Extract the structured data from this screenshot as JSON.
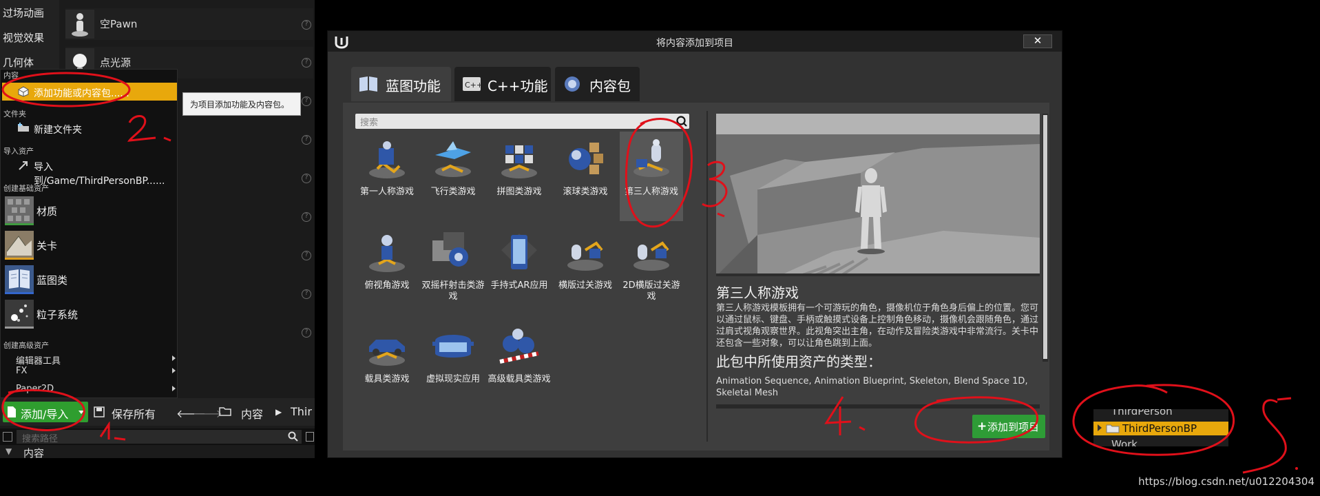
{
  "left_panel": {
    "categories": [
      "过场动画",
      "视觉效果",
      "几何体",
      "内容"
    ],
    "place_items": [
      "空Pawn",
      "点光源"
    ],
    "menu": {
      "sections": {
        "content": "内容",
        "folder": "文件夹",
        "import": "导入资产",
        "basic": "创建基础资产",
        "advanced": "创建高级资产"
      },
      "add_feature": "添加功能或内容包......",
      "new_folder": "新建文件夹",
      "import_to": "导入到/Game/ThirdPersonBP......",
      "basic_assets": [
        "材质",
        "关卡",
        "蓝图类",
        "粒子系统"
      ],
      "advanced_items": [
        "编辑器工具",
        "FX",
        "Paper2D"
      ]
    },
    "tooltip": "为项目添加功能及内容包。",
    "toolbar": {
      "add_import": "添加/导入",
      "save_all": "保存所有",
      "breadcrumb": [
        "内容",
        "Thir"
      ]
    },
    "path_search_placeholder": "搜索路径",
    "tree_root": "内容"
  },
  "annotations": {
    "n1": "1.",
    "n2": "2.",
    "n3": "3.",
    "n4": "4.",
    "n5": "5."
  },
  "dialog": {
    "title": "将内容添加到项目",
    "close": "✕",
    "tabs": [
      {
        "label": "蓝图功能",
        "active": true
      },
      {
        "label": "C++功能",
        "active": false
      },
      {
        "label": "内容包",
        "active": false
      }
    ],
    "search_placeholder": "搜索",
    "templates": [
      "第一人称游戏",
      "飞行类游戏",
      "拼图类游戏",
      "滚球类游戏",
      "第三人称游戏",
      "俯视角游戏",
      "双摇杆射击类游戏",
      "手持式AR应用",
      "横版过关游戏",
      "2D横版过关游戏",
      "载具类游戏",
      "虚拟现实应用",
      "高级载具类游戏"
    ],
    "selected_template": "第三人称游戏",
    "detail": {
      "title": "第三人称游戏",
      "description": "第三人称游戏模板拥有一个可游玩的角色，摄像机位于角色身后偏上的位置。您可以通过鼠标、键盘、手柄或触摸式设备上控制角色移动，摄像机会跟随角色，通过过肩式视角观察世界。此视角突出主角，在动作及冒险类游戏中非常流行。关卡中还包含一些对象，可以让角色跳到上面。",
      "asset_types_title": "此包中所使用资产的类型：",
      "asset_types": "Animation Sequence, Animation Blueprint, Skeleton, Blend Space 1D, Skeletal Mesh"
    },
    "add_button": "添加到项目"
  },
  "tree_snippet": {
    "items": [
      "ThirdPerson",
      "ThirdPersonBP",
      "Work"
    ]
  },
  "watermark": "https://blog.csdn.net/u012204304",
  "colors": {
    "highlight": "#e8a80c",
    "green": "#2e9c36",
    "annotation_red": "#e0101a"
  }
}
